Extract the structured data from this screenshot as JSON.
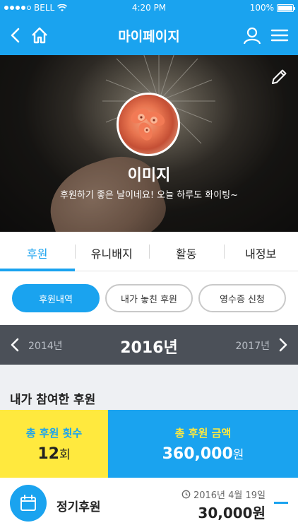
{
  "status": {
    "carrier": "BELL",
    "time": "4:20 PM",
    "battery": "100%"
  },
  "nav": {
    "title": "마이페이지"
  },
  "profile": {
    "name": "이미지",
    "message": "후원하기 좋은 날이네요! 오늘 하루도 화이팅~"
  },
  "tabs": [
    {
      "label": "후원"
    },
    {
      "label": "유니배지"
    },
    {
      "label": "활동"
    },
    {
      "label": "내정보"
    }
  ],
  "filters": [
    {
      "label": "후원내역"
    },
    {
      "label": "내가 놓친 후원"
    },
    {
      "label": "영수증 신청"
    }
  ],
  "year": {
    "prev": "2014년",
    "current": "2016년",
    "next": "2017년"
  },
  "section": {
    "title": "내가 참여한 후원"
  },
  "summary": {
    "count_label": "총 후원 횟수",
    "count_value": "12",
    "count_unit": "회",
    "amount_label": "총 후원 금액",
    "amount_value": "360,000",
    "amount_unit": "원"
  },
  "record": {
    "type": "정기후원",
    "date": "2016년 4월 19일",
    "amount": "30,000원"
  },
  "colors": {
    "accent": "#1aa3ef",
    "highlight": "#ffe93e",
    "year_bar": "#4b5058"
  }
}
